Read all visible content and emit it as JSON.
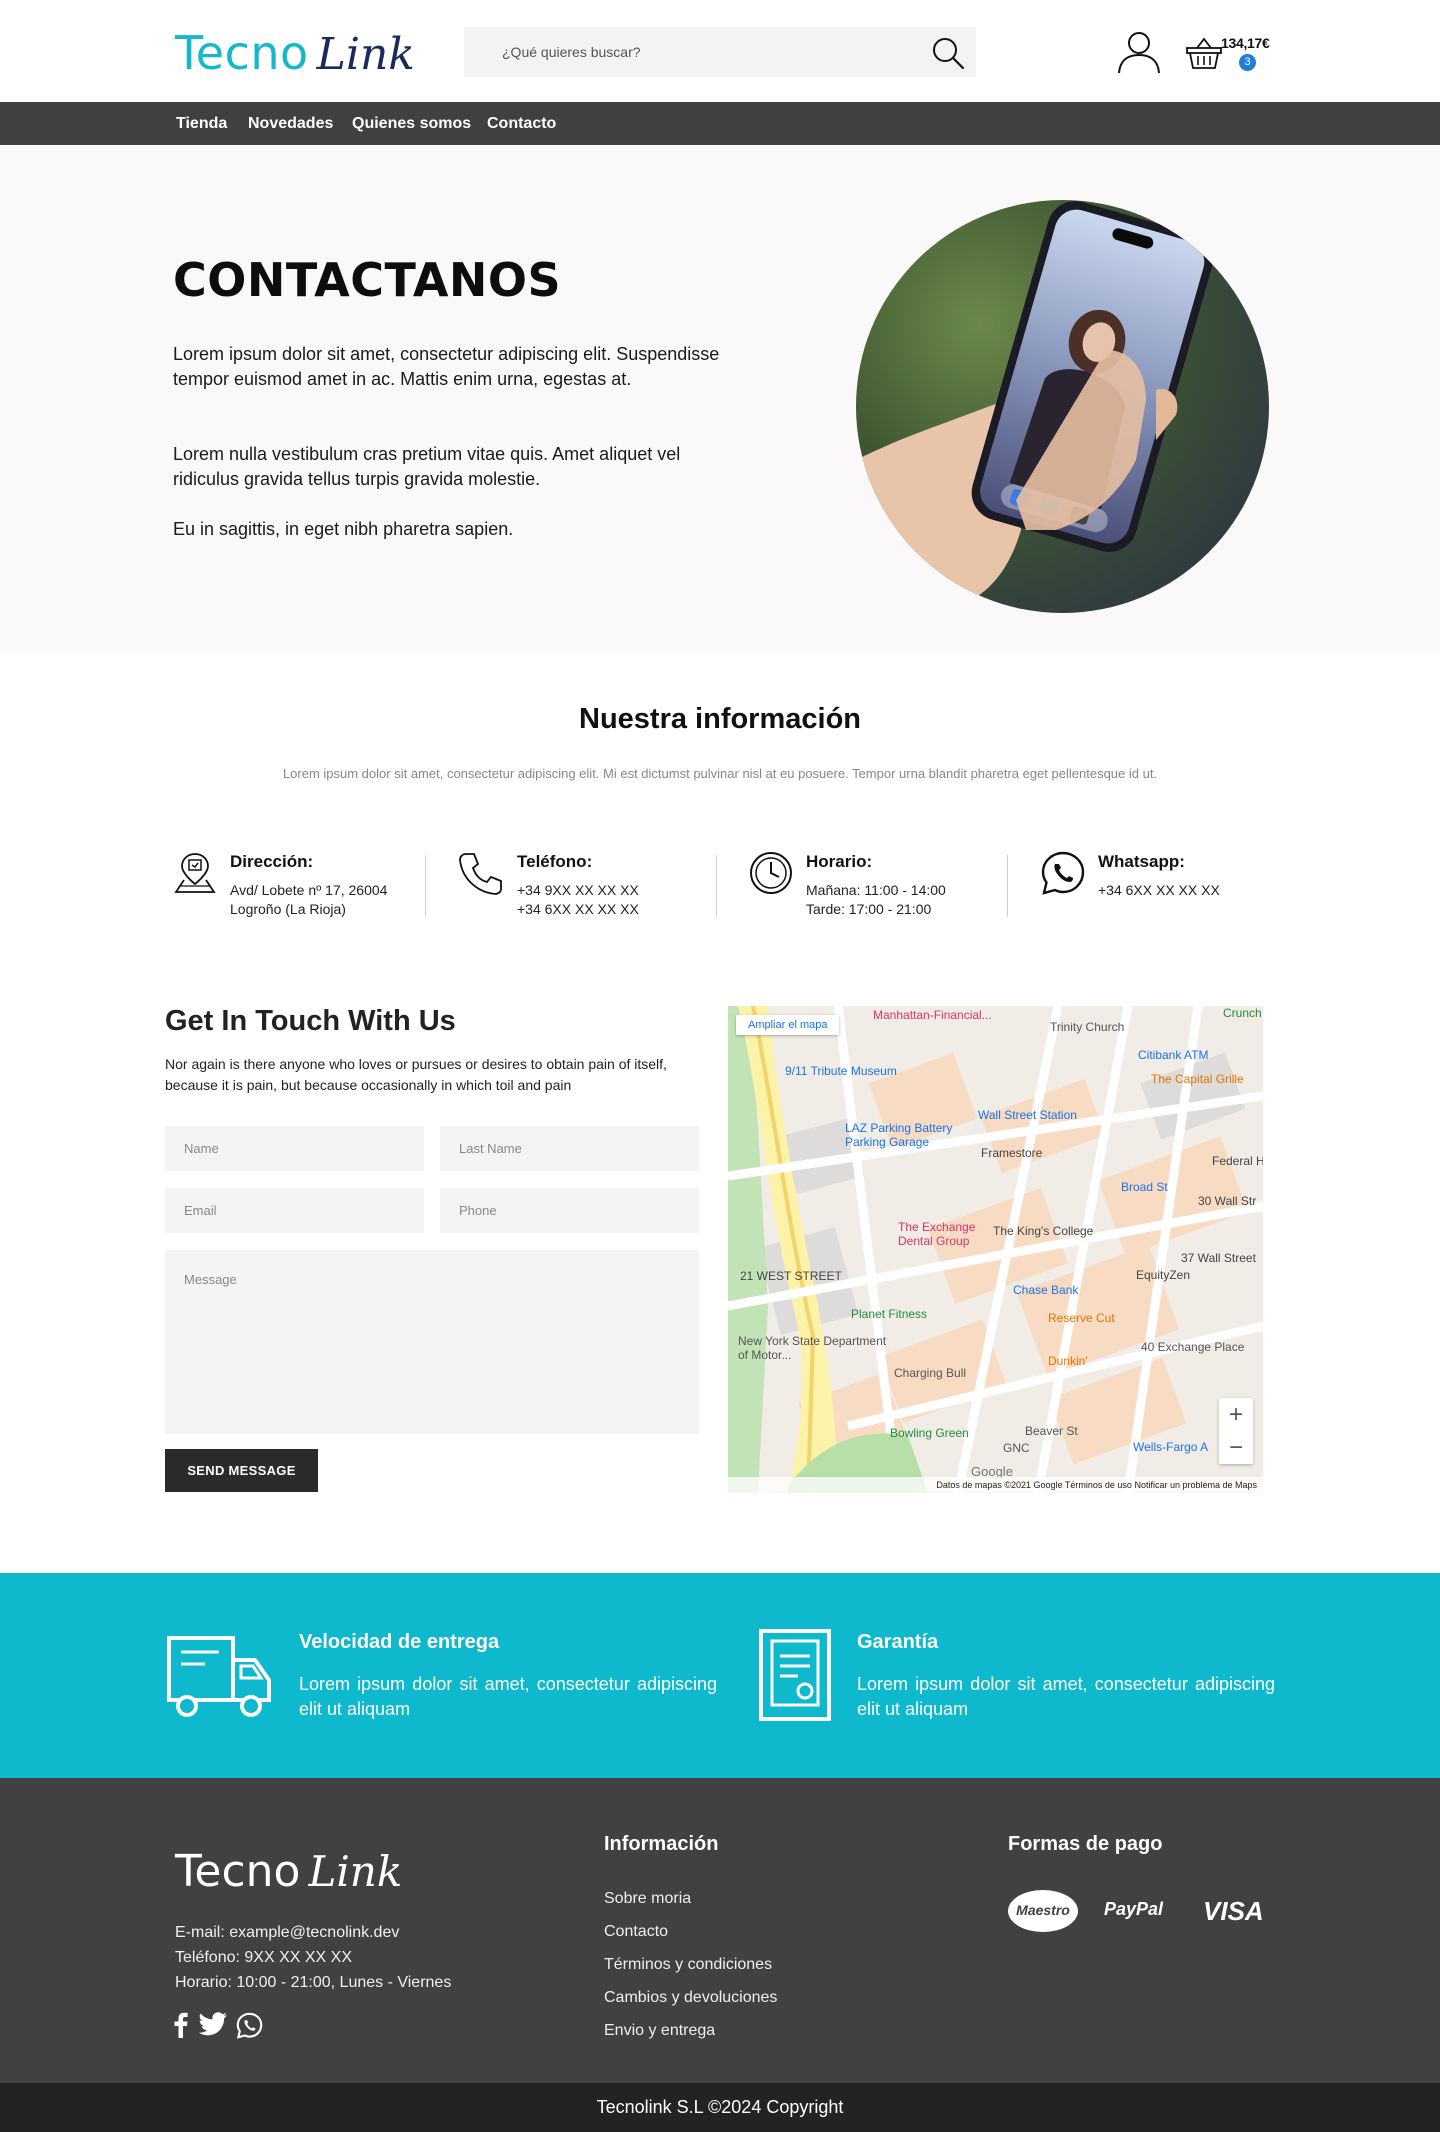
{
  "header": {
    "logo_part1": "Tecno",
    "logo_part2": "Link",
    "search_placeholder": "¿Qué quieres buscar?",
    "cart_total": "134,17€",
    "cart_count": "3",
    "brand_color": "#13b8cc"
  },
  "nav": {
    "items": [
      {
        "label": "Tienda"
      },
      {
        "label": "Novedades"
      },
      {
        "label": "Quienes somos"
      },
      {
        "label": "Contacto"
      }
    ]
  },
  "hero": {
    "title": "CONTACTANOS",
    "p1": "Lorem ipsum dolor sit amet, consectetur adipiscing elit. Suspendisse tempor euismod amet in ac. Mattis enim urna, egestas at.",
    "p2": "Lorem nulla vestibulum cras pretium vitae quis. Amet aliquet vel ridiculus gravida tellus turpis gravida molestie.",
    "p3": "Eu in sagittis, in eget nibh pharetra sapien."
  },
  "info": {
    "title": "Nuestra información",
    "subtitle": "Lorem ipsum dolor sit amet, consectetur adipiscing elit. Mi est dictumst pulvinar nisl at eu posuere. Tempor urna blandit pharetra eget pellentesque id ut.",
    "items": [
      {
        "icon": "map-pin-icon",
        "title": "Dirección:",
        "line1": "Avd/ Lobete nº 17, 26004",
        "line2": "Logroño (La Rioja)"
      },
      {
        "icon": "phone-icon",
        "title": "Teléfono:",
        "line1": "+34 9XX XX XX XX",
        "line2": "+34 6XX XX XX XX"
      },
      {
        "icon": "clock-icon",
        "title": "Horario:",
        "line1": "Mañana: 11:00 - 14:00",
        "line2": "Tarde: 17:00 - 21:00"
      },
      {
        "icon": "whatsapp-icon",
        "title": "Whatsapp:",
        "line1": "+34 6XX XX XX XX",
        "line2": ""
      }
    ]
  },
  "contact": {
    "title": "Get In Touch With Us",
    "text": "Nor again is there anyone who loves or pursues or desires to obtain pain of itself, because it is pain, but because occasionally in which toil and pain",
    "name_placeholder": "Name",
    "lastname_placeholder": "Last Name",
    "email_placeholder": "Email",
    "phone_placeholder": "Phone",
    "message_placeholder": "Message",
    "send_label": "SEND MESSAGE"
  },
  "map": {
    "expand_label": "Ampliar el mapa",
    "labels": [
      "Manhattan-Financial...",
      "9/11 Tribute Museum",
      "Trinity Church",
      "Citibank ATM",
      "The Capital Grille",
      "Wall Street Station",
      "LAZ Parking Battery Parking Garage",
      "Framestore",
      "Federal H",
      "Broad St",
      "30 Wall Str",
      "The Exchange Dental Group",
      "The King's College",
      "37 Wall Street",
      "21 WEST STREET",
      "Chase Bank",
      "EquityZen",
      "Planet Fitness",
      "Reserve Cut",
      "New York State Department of Motor...",
      "40 Exchange Place",
      "Charging Bull",
      "Dunkin'",
      "Bowling Green",
      "Beaver St",
      "GNC",
      "Wells-Fargo A",
      "Crunch"
    ],
    "zoom_in": "+",
    "zoom_out": "−",
    "google": "Google",
    "footer_text": "Datos de mapas ©2021 Google    Términos de uso    Notificar un problema de Maps"
  },
  "features": [
    {
      "icon": "delivery-truck-icon",
      "title": "Velocidad de entrega",
      "text": "Lorem ipsum dolor sit amet, consectetur adipiscing elit ut aliquam"
    },
    {
      "icon": "certificate-icon",
      "title": "Garantía",
      "text": "Lorem ipsum dolor sit amet, consectetur adipiscing elit ut aliquam"
    }
  ],
  "footer": {
    "logo_part1": "Tecno",
    "logo_part2": "Link",
    "email": "E-mail: example@tecnolink.dev",
    "phone": "Teléfono: 9XX XX XX XX",
    "hours": "Horario: 10:00 - 21:00, Lunes - Viernes",
    "info_title": "Información",
    "links": [
      "Sobre moria",
      "Contacto",
      "Términos y condiciones",
      "Cambios y devoluciones",
      "Envio y entrega"
    ],
    "payment_title": "Formas de pago",
    "payments": [
      "Maestro",
      "PayPal",
      "VISA"
    ],
    "copyright": "Tecnolink S.L ©2024 Copyright"
  }
}
